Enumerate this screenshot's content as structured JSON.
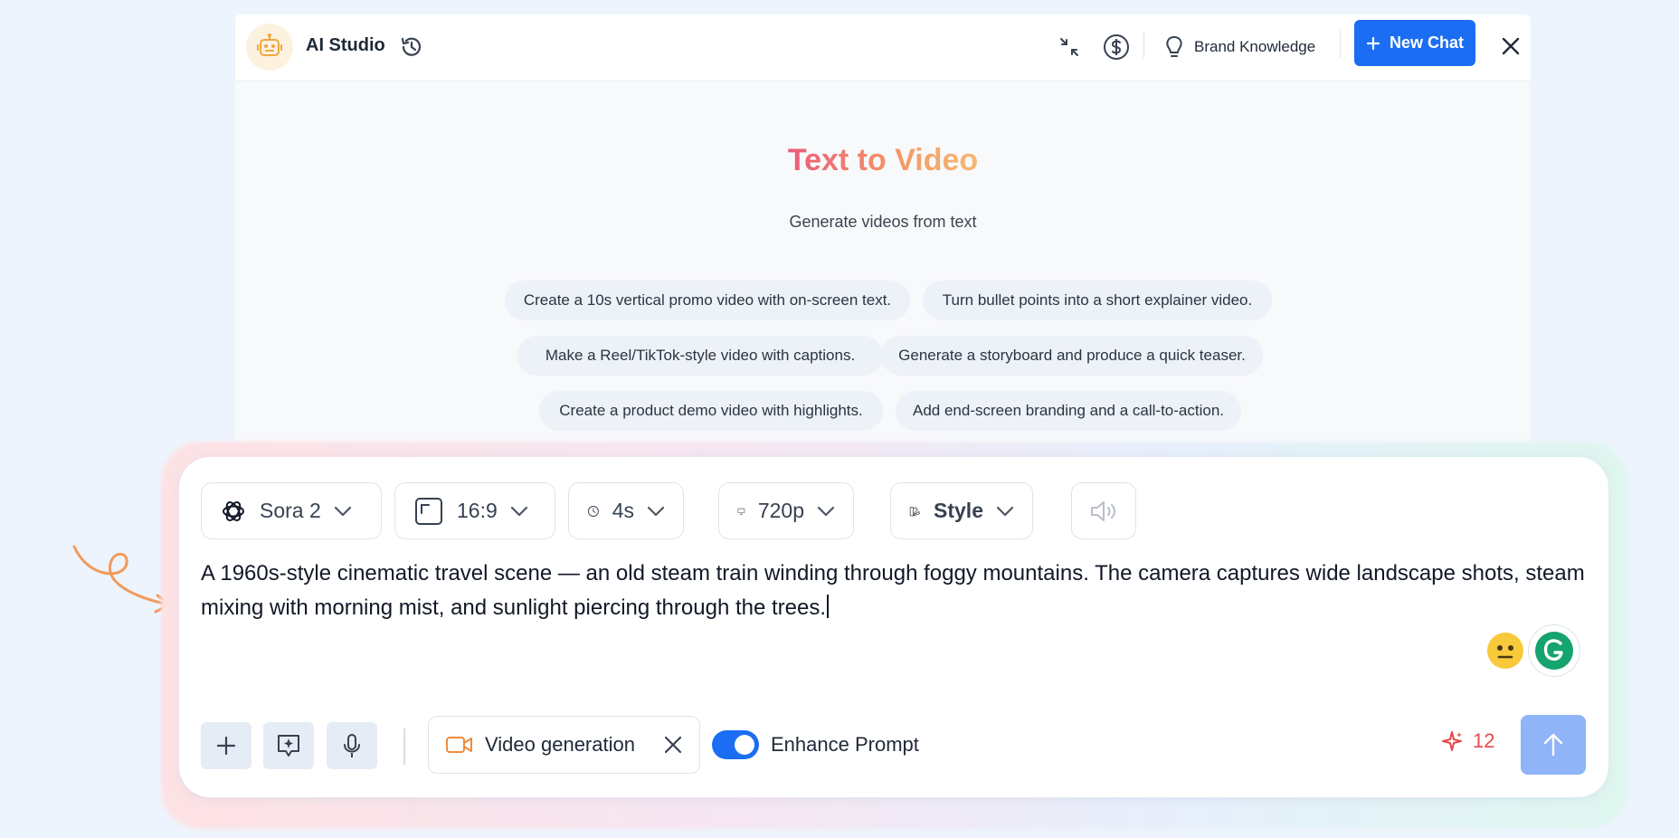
{
  "header": {
    "app_title": "AI Studio",
    "brand_knowledge_label": "Brand Knowledge",
    "new_chat_label": "New Chat"
  },
  "hero": {
    "title": "Text to Video",
    "subtitle": "Generate videos from text"
  },
  "suggestions": [
    "Create a 10s vertical promo video with on-screen text.",
    "Turn bullet points into a short explainer video.",
    "Make a Reel/TikTok-style video with captions.",
    "Generate a storyboard and produce a quick teaser.",
    "Create a product demo video with highlights.",
    "Add end-screen branding and a call-to-action."
  ],
  "options": {
    "model": "Sora 2",
    "aspect_ratio": "16:9",
    "duration": "4s",
    "resolution": "720p",
    "style": "Style"
  },
  "prompt_text": "A 1960s-style cinematic travel scene — an old steam train winding through foggy mountains. The camera captures wide landscape shots, steam mixing with morning mist, and sunlight piercing through the trees.",
  "footer": {
    "mode_label": "Video generation",
    "enhance_prompt_label": "Enhance Prompt",
    "enhance_enabled": true,
    "credits": "12"
  },
  "colors": {
    "accent": "#1b6ef3",
    "send_disabled": "#8fb4f7",
    "credits": "#e5484d",
    "video_icon": "#f08a3c"
  },
  "icons": {
    "avatar": "robot-icon",
    "history": "history-icon",
    "collapse": "collapse-icon",
    "pricing": "dollar-icon",
    "brand_knowledge": "lightbulb-icon",
    "close": "close-icon",
    "model": "openai-icon",
    "aspect": "aspect-ratio-icon",
    "duration": "clock-icon",
    "resolution": "monitor-icon",
    "style": "palette-icon",
    "audio": "speaker-icon",
    "attach": "plus-icon",
    "prompt_helper": "sparkle-chat-icon",
    "voice": "microphone-icon",
    "video": "video-camera-icon",
    "credits": "sparkle-icon",
    "send": "arrow-up-icon"
  }
}
